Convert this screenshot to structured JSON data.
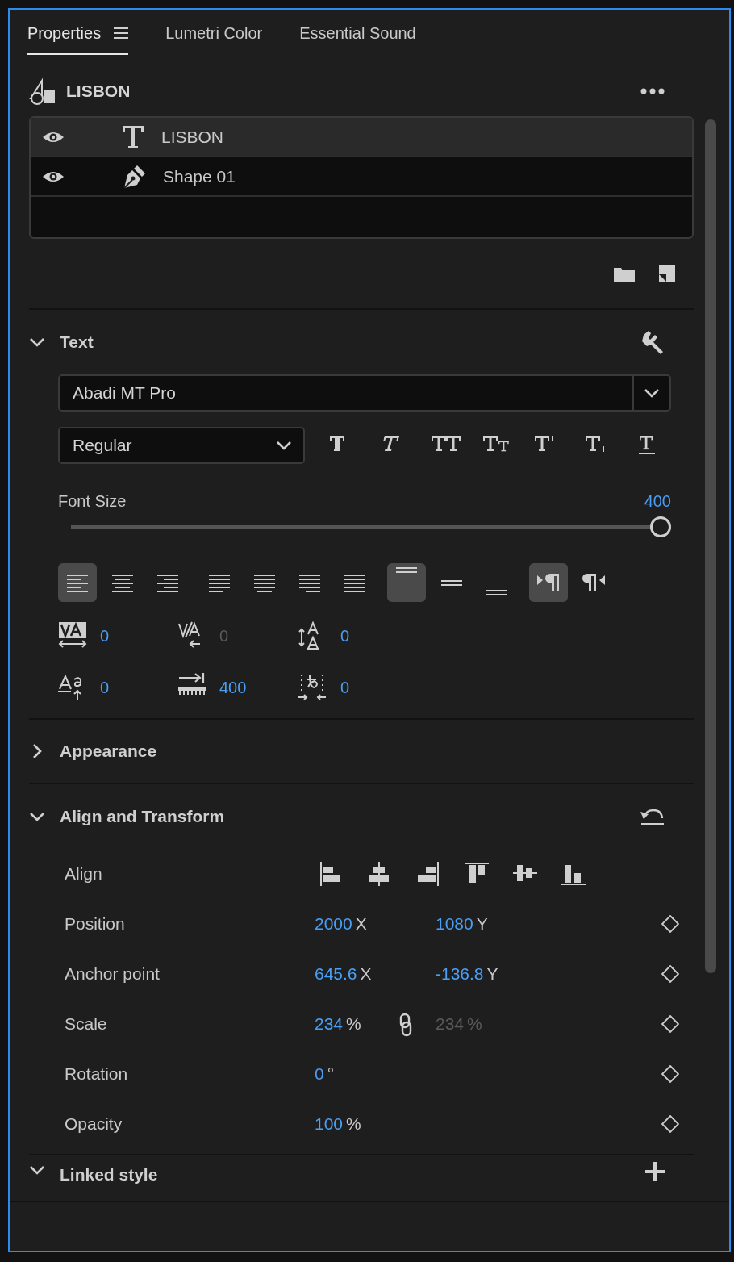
{
  "tabs": [
    {
      "label": "Properties",
      "selected": true
    },
    {
      "label": "Lumetri Color",
      "selected": false
    },
    {
      "label": "Essential Sound",
      "selected": false
    }
  ],
  "clip": {
    "title": "LISBON"
  },
  "layers": [
    {
      "name": "LISBON",
      "kind": "text",
      "visible": true,
      "selected": true
    },
    {
      "name": "Shape 01",
      "kind": "shape",
      "visible": true,
      "selected": false
    }
  ],
  "text_section": {
    "title": "Text",
    "expanded": true,
    "font": "Abadi MT Pro",
    "style": "Regular",
    "styles": [
      {
        "kind": "bold"
      },
      {
        "kind": "italic"
      },
      {
        "kind": "all-caps"
      },
      {
        "kind": "small-caps"
      },
      {
        "kind": "superscript"
      },
      {
        "kind": "subscript"
      },
      {
        "kind": "underline"
      }
    ],
    "font_size": {
      "label": "Font Size",
      "value": "400",
      "level": 1
    },
    "paragraph": [
      {
        "kind": "left",
        "selected": true
      },
      {
        "kind": "center",
        "selected": false
      },
      {
        "kind": "right",
        "selected": false
      },
      {
        "kind": "justify-left",
        "selected": false
      },
      {
        "kind": "justify-center",
        "selected": false
      },
      {
        "kind": "justify-right",
        "selected": false
      },
      {
        "kind": "justify-all",
        "selected": false
      },
      {
        "kind": "top",
        "selected": true
      },
      {
        "kind": "middle",
        "selected": false
      },
      {
        "kind": "bottom",
        "selected": false
      },
      {
        "kind": "ltr",
        "selected": true
      },
      {
        "kind": "rtl",
        "selected": false
      }
    ],
    "metrics": [
      {
        "kind": "kerning",
        "value": "0",
        "disabled": false
      },
      {
        "kind": "tracking",
        "value": "0",
        "disabled": true
      },
      {
        "kind": "leading",
        "value": "0",
        "disabled": false
      },
      {
        "kind": "baseline",
        "value": "0",
        "disabled": false
      },
      {
        "kind": "tabs",
        "value": "400",
        "disabled": false
      },
      {
        "kind": "tsume",
        "value": "0",
        "disabled": false
      }
    ]
  },
  "appearance": {
    "title": "Appearance",
    "expanded": false
  },
  "transform": {
    "title": "Align and Transform",
    "expanded": true,
    "align_label": "Align",
    "align_buttons": [
      {
        "kind": "left"
      },
      {
        "kind": "h-center"
      },
      {
        "kind": "right"
      },
      {
        "kind": "top"
      },
      {
        "kind": "v-center"
      },
      {
        "kind": "bottom"
      }
    ],
    "properties": [
      {
        "label": "Position",
        "linked": false,
        "values": [
          {
            "value": "2000",
            "unit": "X",
            "disabled": false
          },
          {
            "value": "1080",
            "unit": "Y",
            "disabled": false
          }
        ]
      },
      {
        "label": "Anchor point",
        "linked": false,
        "values": [
          {
            "value": "645.6",
            "unit": "X",
            "disabled": false
          },
          {
            "value": "-136.8",
            "unit": "Y",
            "disabled": false
          }
        ]
      },
      {
        "label": "Scale",
        "linked": true,
        "values": [
          {
            "value": "234",
            "unit": "%",
            "disabled": false
          },
          {
            "value": "234",
            "unit": "%",
            "disabled": true
          }
        ]
      },
      {
        "label": "Rotation",
        "linked": false,
        "values": [
          {
            "value": "0",
            "unit": "°",
            "disabled": false
          }
        ]
      },
      {
        "label": "Opacity",
        "linked": false,
        "values": [
          {
            "value": "100",
            "unit": "%",
            "disabled": false
          }
        ]
      }
    ]
  },
  "linked_style": {
    "title": "Linked style",
    "expanded": true
  }
}
